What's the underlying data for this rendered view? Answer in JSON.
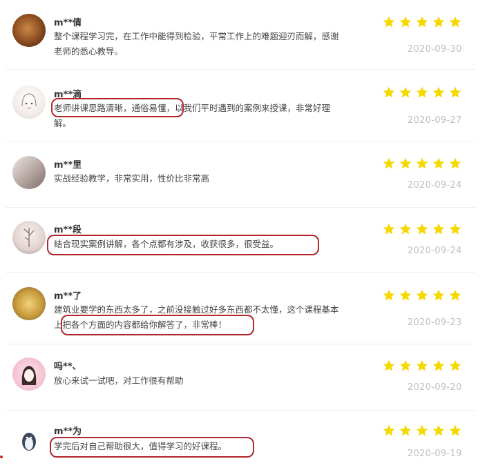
{
  "reviews": [
    {
      "name": "m**倩",
      "lines": [
        "整个课程学习完，在工作中能得到检验，平常工作上的难题迎刃而解，感谢",
        "老师的悉心教导。"
      ],
      "date": "2020-09-30",
      "stars": 5
    },
    {
      "name": "m**滴",
      "lines": [
        "老师讲课思路清晰，通俗易懂，以我们平时遇到的案例来授课，非常好理",
        "解。"
      ],
      "date": "2020-09-27",
      "stars": 5
    },
    {
      "name": "m**里",
      "lines": [
        "实战经验教学，非常实用，性价比非常高"
      ],
      "date": "2020-09-24",
      "stars": 5
    },
    {
      "name": "m**段",
      "lines": [
        "结合现实案例讲解，各个点都有涉及，收获很多，很受益。"
      ],
      "date": "2020-09-24",
      "stars": 5
    },
    {
      "name": "m**了",
      "lines": [
        "建筑业要学的东西太多了，之前没接触过好多东西都不太懂，这个课程基本",
        "上把各个方面的内容都给你解答了，非常棒！"
      ],
      "date": "2020-09-23",
      "stars": 5
    },
    {
      "name": "吗**、",
      "lines": [
        "放心来试一试吧，对工作很有帮助"
      ],
      "date": "2020-09-20",
      "stars": 5
    },
    {
      "name": "m**为",
      "lines": [
        "学完后对自己帮助很大，值得学习的好课程。"
      ],
      "date": "2020-09-19",
      "stars": 5
    }
  ],
  "colors": {
    "star": "#f5d800",
    "highlight": "#b3262c",
    "date": "#bfbfbf"
  }
}
